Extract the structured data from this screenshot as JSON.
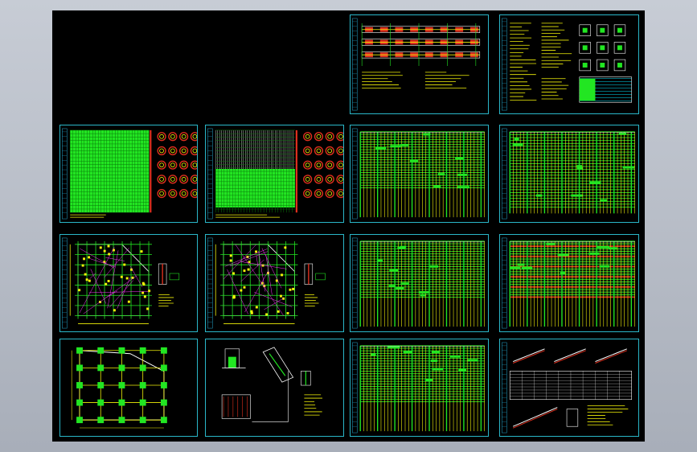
{
  "colors": {
    "frame": "#2ab7c9",
    "grid_green": "#22e622",
    "grid_yellow": "#f2f20a",
    "line_white": "#ffffff",
    "accent_red": "#e0301e",
    "accent_cyan": "#00e5ff",
    "accent_magenta": "#ff3cff",
    "title_block": "#1f8fb0"
  },
  "sheets": [
    {
      "id": "sheet-r1c3",
      "kind": "detail-long"
    },
    {
      "id": "sheet-r1c4",
      "kind": "notes-details"
    },
    {
      "id": "sheet-r2c1",
      "kind": "table-circles"
    },
    {
      "id": "sheet-r2c2",
      "kind": "table-circles-light"
    },
    {
      "id": "sheet-r2c3",
      "kind": "schedule"
    },
    {
      "id": "sheet-r2c4",
      "kind": "schedule-dense"
    },
    {
      "id": "sheet-r3c1",
      "kind": "floor-plan"
    },
    {
      "id": "sheet-r3c2",
      "kind": "floor-plan"
    },
    {
      "id": "sheet-r3c3",
      "kind": "schedule"
    },
    {
      "id": "sheet-r3c4",
      "kind": "schedule-red"
    },
    {
      "id": "sheet-r4c1",
      "kind": "foundation-plan"
    },
    {
      "id": "sheet-r4c2",
      "kind": "section-details"
    },
    {
      "id": "sheet-r4c3",
      "kind": "schedule"
    },
    {
      "id": "sheet-r4c4",
      "kind": "stair-details"
    }
  ]
}
